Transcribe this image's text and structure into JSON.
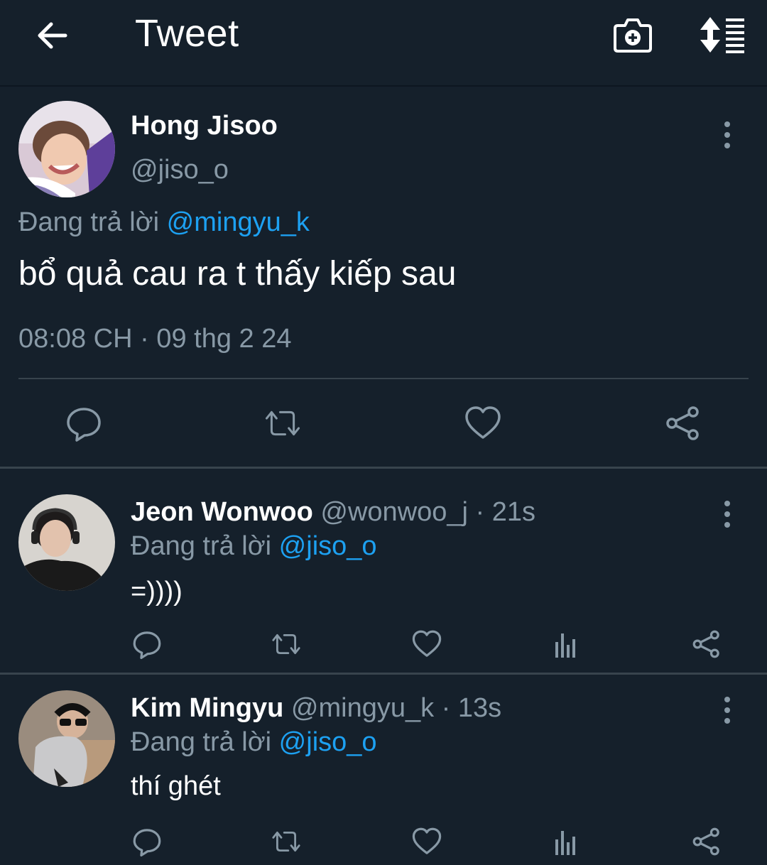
{
  "header": {
    "title": "Tweet"
  },
  "main_tweet": {
    "name": "Hong Jisoo",
    "handle": "@jiso_o",
    "reply_prefix": "Đang trả lời",
    "reply_mention": "@mingyu_k",
    "text": "bổ quả cau ra t thấy kiếp sau",
    "timestamp": "08:08 CH · 09 thg 2 24"
  },
  "replies": [
    {
      "name": "Jeon Wonwoo",
      "handle": "@wonwoo_j",
      "time": "· 21s",
      "reply_prefix": "Đang trả lời",
      "reply_mention": "@jiso_o",
      "text": "=))))"
    },
    {
      "name": "Kim Mingyu",
      "handle": "@mingyu_k",
      "time": "· 13s",
      "reply_prefix": "Đang trả lời",
      "reply_mention": "@jiso_o",
      "text": "thí ghét"
    }
  ],
  "colors": {
    "background": "#15202b",
    "accent": "#1da1f2",
    "muted": "#8899a6",
    "divider": "#38444d"
  }
}
